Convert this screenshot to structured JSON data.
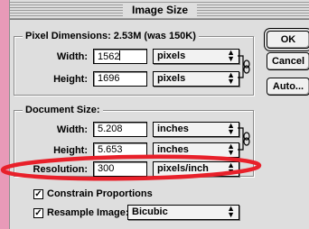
{
  "window": {
    "title": "Image Size"
  },
  "pixel_dimensions": {
    "label": "Pixel Dimensions: 2.53M (was 150K)",
    "width_label": "Width:",
    "width_value": "1562",
    "width_unit": "pixels",
    "height_label": "Height:",
    "height_value": "1696",
    "height_unit": "pixels"
  },
  "document_size": {
    "label": "Document Size:",
    "width_label": "Width:",
    "width_value": "5.208",
    "width_unit": "inches",
    "height_label": "Height:",
    "height_value": "5.653",
    "height_unit": "inches",
    "resolution_label": "Resolution:",
    "resolution_value": "300",
    "resolution_unit": "pixels/inch"
  },
  "options": {
    "constrain_label": "Constrain Proportions",
    "constrain_checked": true,
    "resample_label": "Resample Image:",
    "resample_checked": true,
    "resample_method": "Bicubic"
  },
  "buttons": {
    "ok": "OK",
    "cancel": "Cancel",
    "auto": "Auto..."
  },
  "icons": {
    "checkmark": "✓",
    "select_arrows": "⬍",
    "chain": "chain-link-icon"
  },
  "colors": {
    "highlight": "#e8202a",
    "background": "#e89ab8",
    "dialog": "#dedede"
  }
}
